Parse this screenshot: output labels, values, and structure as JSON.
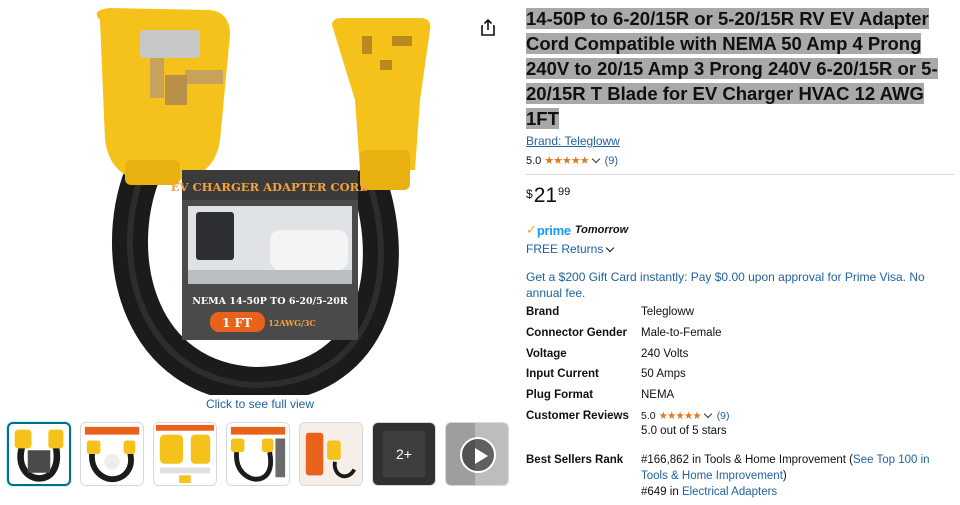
{
  "gallery": {
    "main_image_alt": "EV charger adapter cord product photo",
    "box_label_top": "EV CHARGER ADAPTER CORD",
    "box_label_spec": "NEMA 14-50P TO 6-20/5-20R",
    "box_label_length": "1 FT",
    "box_label_gauge": "12AWG/3C",
    "click_full_view": "Click to see full view",
    "more_count": "2+"
  },
  "product": {
    "title": "14-50P to 6-20/15R or 5-20/15R RV EV Adapter Cord Compatible with NEMA 50 Amp 4 Prong 240V to 20/15 Amp 3 Prong 240V 6-20/15R or 5-20/15R T Blade for EV Charger HVAC 12 AWG 1FT",
    "brand_link": "Brand: Telegloww",
    "rating": "5.0",
    "stars": "★★★★★",
    "rating_count": "(9)",
    "price_symbol": "$",
    "price_whole": "21",
    "price_fraction": "99",
    "prime_check": "✓",
    "prime_label": "prime",
    "prime_day": "Tomorrow",
    "returns": "FREE Returns",
    "promo": "Get a $200 Gift Card instantly: Pay $0.00 upon approval for Prime Visa. No annual fee."
  },
  "specs": [
    {
      "key": "Brand",
      "value": "Telegloww"
    },
    {
      "key": "Connector Gender",
      "value": "Male-to-Female"
    },
    {
      "key": "Voltage",
      "value": "240 Volts"
    },
    {
      "key": "Input Current",
      "value": "50 Amps"
    },
    {
      "key": "Plug Format",
      "value": "NEMA"
    }
  ],
  "customer_reviews": {
    "key": "Customer Reviews",
    "rating": "5.0",
    "stars": "★★★★★",
    "count": "(9)",
    "summary": "5.0 out of 5 stars"
  },
  "best_sellers": {
    "key": "Best Sellers Rank",
    "rank1_prefix": "#166,862 in Tools & Home Improvement (",
    "rank1_link": "See Top 100 in Tools & Home Improvement",
    "rank1_suffix": ")",
    "rank2_prefix": "#649 in ",
    "rank2_link": "Electrical Adapters"
  },
  "colors": {
    "link": "#2162a1",
    "star": "#de7921",
    "prime": "#1a98ff",
    "title_highlight": "#a9a9a9",
    "plug_yellow": "#f5c21b",
    "selected_border": "#007185"
  }
}
